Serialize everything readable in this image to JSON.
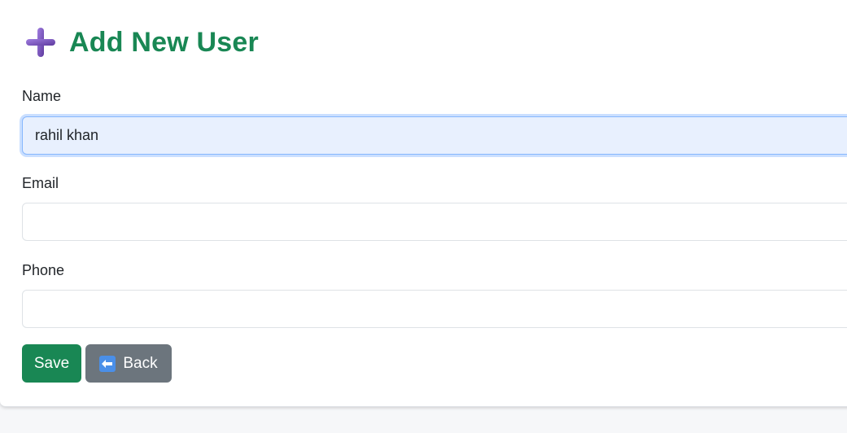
{
  "header": {
    "title": "Add New User",
    "icon": "plus-icon"
  },
  "form": {
    "name_label": "Name",
    "name_value": "rahil khan",
    "email_label": "Email",
    "email_value": "",
    "phone_label": "Phone",
    "phone_value": ""
  },
  "buttons": {
    "save_label": "Save",
    "back_label": "Back",
    "back_icon": "left-arrow-icon"
  },
  "colors": {
    "title": "#198754",
    "save_button": "#198754",
    "back_button": "#6c757d",
    "plus_icon": "#7b52b9",
    "focused_input_bg": "#e8f0fe"
  }
}
